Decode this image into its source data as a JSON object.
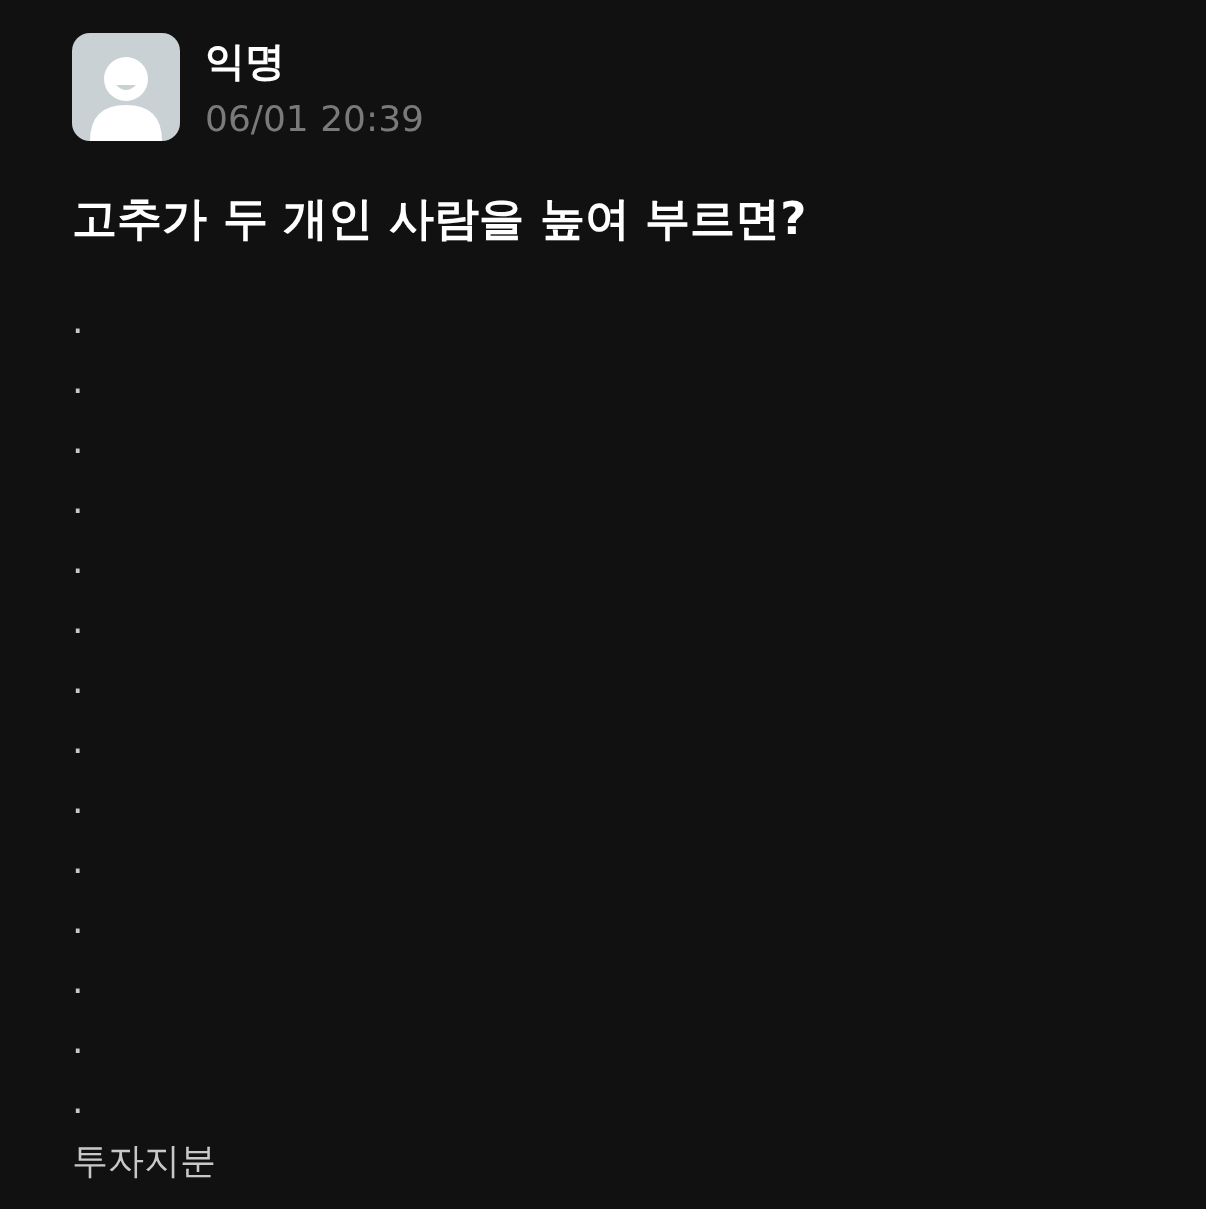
{
  "post": {
    "author": "익명",
    "time": "06/01 20:39",
    "title": "고추가 두 개인 사람을 높여 부르면?",
    "body_lines": [
      ".",
      ".",
      ".",
      ".",
      ".",
      ".",
      ".",
      ".",
      ".",
      ".",
      ".",
      ".",
      ".",
      ".",
      "투자지분"
    ]
  }
}
